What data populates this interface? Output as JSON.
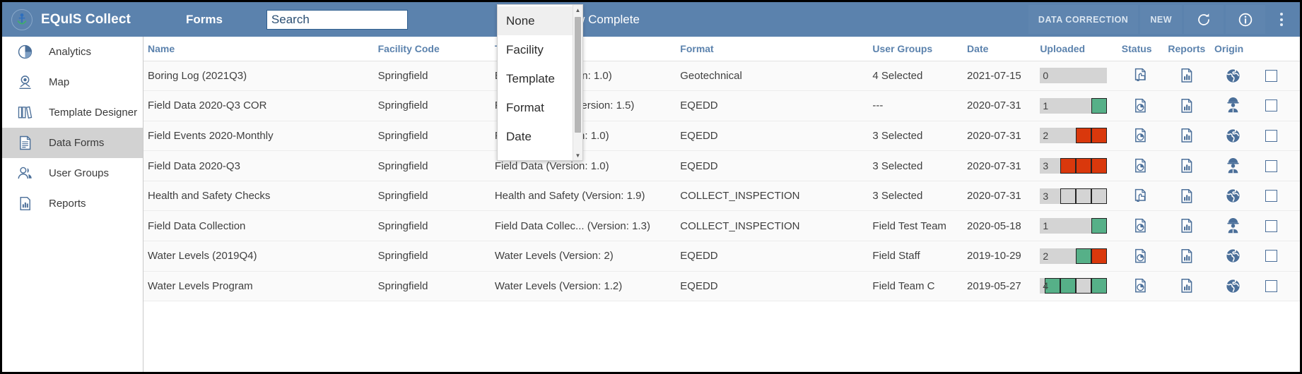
{
  "header": {
    "logo_icon": "equis-anchor-logo-icon",
    "app_title": "EQuIS Collect",
    "section_title": "Forms",
    "search": {
      "value": "",
      "placeholder": "Search"
    },
    "show_complete": {
      "label": "Show Complete",
      "checked": false
    },
    "buttons": [
      {
        "label": "DATA CORRECTION",
        "name": "data-correction-button"
      },
      {
        "label": "NEW",
        "name": "new-button"
      }
    ],
    "refresh_icon": "refresh-icon",
    "info_icon": "info-icon",
    "menu_icon": "kebab-menu-icon"
  },
  "dropdown": {
    "open": true,
    "items": [
      {
        "label": "None",
        "selected": true
      },
      {
        "label": "Facility",
        "selected": false
      },
      {
        "label": "Template",
        "selected": false
      },
      {
        "label": "Format",
        "selected": false
      },
      {
        "label": "Date",
        "selected": false
      }
    ]
  },
  "sidebar": {
    "items": [
      {
        "label": "Analytics",
        "icon": "pie-chart-icon",
        "active": false
      },
      {
        "label": "Map",
        "icon": "map-pin-icon",
        "active": false
      },
      {
        "label": "Template Designer",
        "icon": "books-icon",
        "active": false
      },
      {
        "label": "Data Forms",
        "icon": "document-icon",
        "active": true
      },
      {
        "label": "User Groups",
        "icon": "users-icon",
        "active": false
      },
      {
        "label": "Reports",
        "icon": "report-chart-icon",
        "active": false
      }
    ]
  },
  "table": {
    "columns": [
      "Name",
      "Facility Code",
      "Template",
      "Format",
      "User Groups",
      "Date",
      "Uploaded",
      "Status",
      "Reports",
      "Origin",
      ""
    ],
    "rows": [
      {
        "name": "Boring Log (2021Q3)",
        "facility_code": "Springfield",
        "template": "Boring Log (Version: 1.0)",
        "format": "Geotechnical",
        "user_groups": "4 Selected",
        "date": "2021-07-15",
        "uploaded_count": "0",
        "uploaded_segments": [],
        "status_icon": "document-click-icon",
        "reports_icon": "report-chart-icon",
        "origin_icon": "globe-icon",
        "checked": false
      },
      {
        "name": "Field Data 2020-Q3 COR",
        "facility_code": "Springfield",
        "template": "Field Data Co... (Version: 1.5)",
        "format": "EQEDD",
        "user_groups": "---",
        "date": "2020-07-31",
        "uploaded_count": "1",
        "uploaded_segments": [
          "green"
        ],
        "status_icon": "document-pie-icon",
        "reports_icon": "report-chart-icon",
        "origin_icon": "field-worker-icon",
        "checked": false
      },
      {
        "name": "Field Events 2020-Monthly",
        "facility_code": "Springfield",
        "template": "Field Data (Version: 1.0)",
        "format": "EQEDD",
        "user_groups": "3 Selected",
        "date": "2020-07-31",
        "uploaded_count": "2",
        "uploaded_segments": [
          "red",
          "red"
        ],
        "status_icon": "document-pie-icon",
        "reports_icon": "report-chart-icon",
        "origin_icon": "globe-icon",
        "checked": false
      },
      {
        "name": "Field Data 2020-Q3",
        "facility_code": "Springfield",
        "template": "Field Data (Version: 1.0)",
        "format": "EQEDD",
        "user_groups": "3 Selected",
        "date": "2020-07-31",
        "uploaded_count": "3",
        "uploaded_segments": [
          "red",
          "red",
          "red"
        ],
        "status_icon": "document-pie-icon",
        "reports_icon": "report-chart-icon",
        "origin_icon": "field-worker-icon",
        "checked": false
      },
      {
        "name": "Health and Safety Checks",
        "facility_code": "Springfield",
        "template": "Health and Safety (Version: 1.9)",
        "format": "COLLECT_INSPECTION",
        "user_groups": "3 Selected",
        "date": "2020-07-31",
        "uploaded_count": "3",
        "uploaded_segments": [
          "grey",
          "grey",
          "grey"
        ],
        "status_icon": "document-click-icon",
        "reports_icon": "report-chart-icon",
        "origin_icon": "globe-icon",
        "checked": false
      },
      {
        "name": "Field Data Collection",
        "facility_code": "Springfield",
        "template": "Field Data Collec... (Version: 1.3)",
        "format": "COLLECT_INSPECTION",
        "user_groups": "Field Test Team",
        "date": "2020-05-18",
        "uploaded_count": "1",
        "uploaded_segments": [
          "green"
        ],
        "status_icon": "document-pie-icon",
        "reports_icon": "report-chart-icon",
        "origin_icon": "field-worker-icon",
        "checked": false
      },
      {
        "name": "Water Levels (2019Q4)",
        "facility_code": "Springfield",
        "template": "Water Levels (Version: 2)",
        "format": "EQEDD",
        "user_groups": "Field Staff",
        "date": "2019-10-29",
        "uploaded_count": "2",
        "uploaded_segments": [
          "green",
          "red"
        ],
        "status_icon": "document-pie-icon",
        "reports_icon": "report-chart-icon",
        "origin_icon": "globe-icon",
        "checked": false
      },
      {
        "name": "Water Levels Program",
        "facility_code": "Springfield",
        "template": "Water Levels (Version: 1.2)",
        "format": "EQEDD",
        "user_groups": "Field Team C",
        "date": "2019-05-27",
        "uploaded_count": "4",
        "uploaded_segments": [
          "green",
          "green",
          "grey",
          "green"
        ],
        "status_icon": "document-pie-icon",
        "reports_icon": "report-chart-icon",
        "origin_icon": "globe-icon",
        "checked": false
      }
    ]
  },
  "colors": {
    "header_blue": "#5b82ad",
    "icon_blue": "#4b6f99",
    "segment_green": "#56b088",
    "segment_red": "#d9380c",
    "segment_grey": "#d4d4d4",
    "sidebar_active": "#d2d2d2"
  }
}
